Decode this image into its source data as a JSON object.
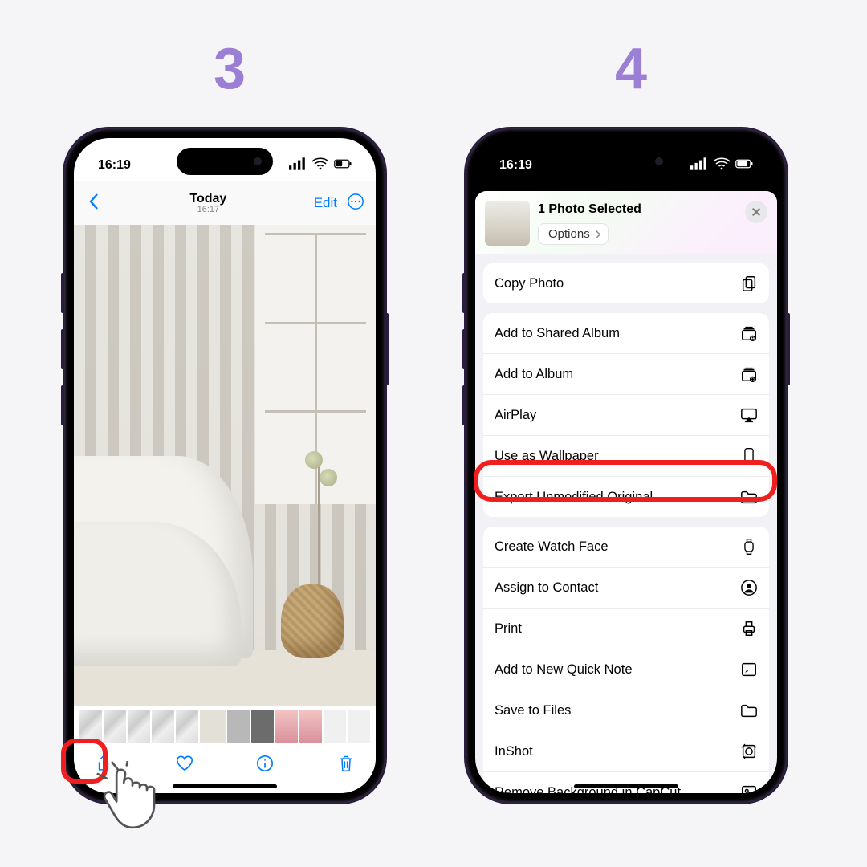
{
  "steps": {
    "left": "3",
    "right": "4"
  },
  "status": {
    "time": "16:19"
  },
  "phone3": {
    "title": "Today",
    "subtitle": "16:17",
    "edit": "Edit"
  },
  "phone4": {
    "selected": "1 Photo Selected",
    "options": "Options",
    "groups": [
      [
        {
          "label": "Copy Photo",
          "icon": "copy"
        }
      ],
      [
        {
          "label": "Add to Shared Album",
          "icon": "shared-album"
        },
        {
          "label": "Add to Album",
          "icon": "album"
        },
        {
          "label": "AirPlay",
          "icon": "airplay"
        },
        {
          "label": "Use as Wallpaper",
          "icon": "phone",
          "highlight": true
        },
        {
          "label": "Export Unmodified Original",
          "icon": "folder"
        }
      ],
      [
        {
          "label": "Create Watch Face",
          "icon": "watch"
        },
        {
          "label": "Assign to Contact",
          "icon": "contact"
        },
        {
          "label": "Print",
          "icon": "print"
        },
        {
          "label": "Add to New Quick Note",
          "icon": "note"
        },
        {
          "label": "Save to Files",
          "icon": "folder"
        },
        {
          "label": "InShot",
          "icon": "inshot"
        },
        {
          "label": "Remove Background in CapCut",
          "icon": "image"
        }
      ]
    ]
  }
}
